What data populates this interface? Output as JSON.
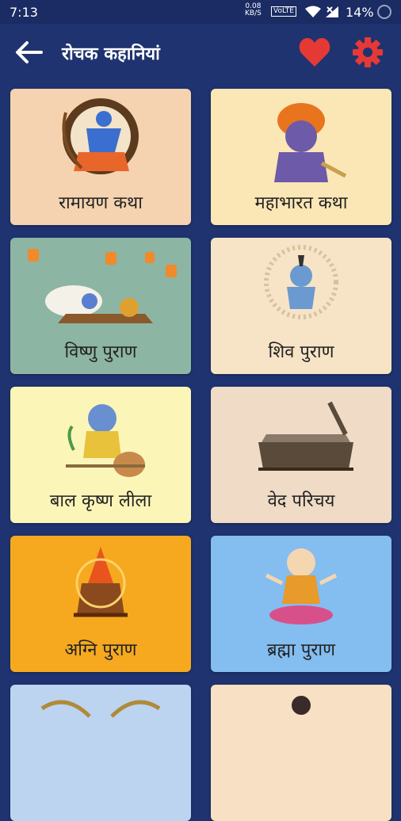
{
  "status": {
    "time": "7:13",
    "net_speed": "0.08",
    "net_unit": "KB/S",
    "volte": "VoLTE",
    "battery": "14%"
  },
  "appbar": {
    "title": "रोचक कहानियां"
  },
  "colors": {
    "background": "#1f3370",
    "accent": "#e53935"
  },
  "stories": [
    {
      "label": "रामायण कथा",
      "bg": "#f5d3b0",
      "icon": "rama-illustration"
    },
    {
      "label": "महाभारत कथा",
      "bg": "#fbe6b6",
      "icon": "krishna-illustration"
    },
    {
      "label": "विष्णु पुराण",
      "bg": "#8db5a4",
      "icon": "vishnu-illustration"
    },
    {
      "label": "शिव पुराण",
      "bg": "#f7e4c6",
      "icon": "shiva-illustration"
    },
    {
      "label": "बाल कृष्ण लीला",
      "bg": "#fbf5b8",
      "icon": "bal-krishna-illustration"
    },
    {
      "label": "वेद परिचय",
      "bg": "#f0dbc7",
      "icon": "vedas-scroll-illustration"
    },
    {
      "label": "अग्नि पुराण",
      "bg": "#f6a91f",
      "icon": "agni-fire-illustration"
    },
    {
      "label": "ब्रह्मा पुराण",
      "bg": "#84bdf0",
      "icon": "brahma-illustration"
    },
    {
      "label": "",
      "bg": "#bcd4f0",
      "icon": "partial-illustration"
    },
    {
      "label": "",
      "bg": "#f7e0c4",
      "icon": "partial-illustration"
    }
  ]
}
